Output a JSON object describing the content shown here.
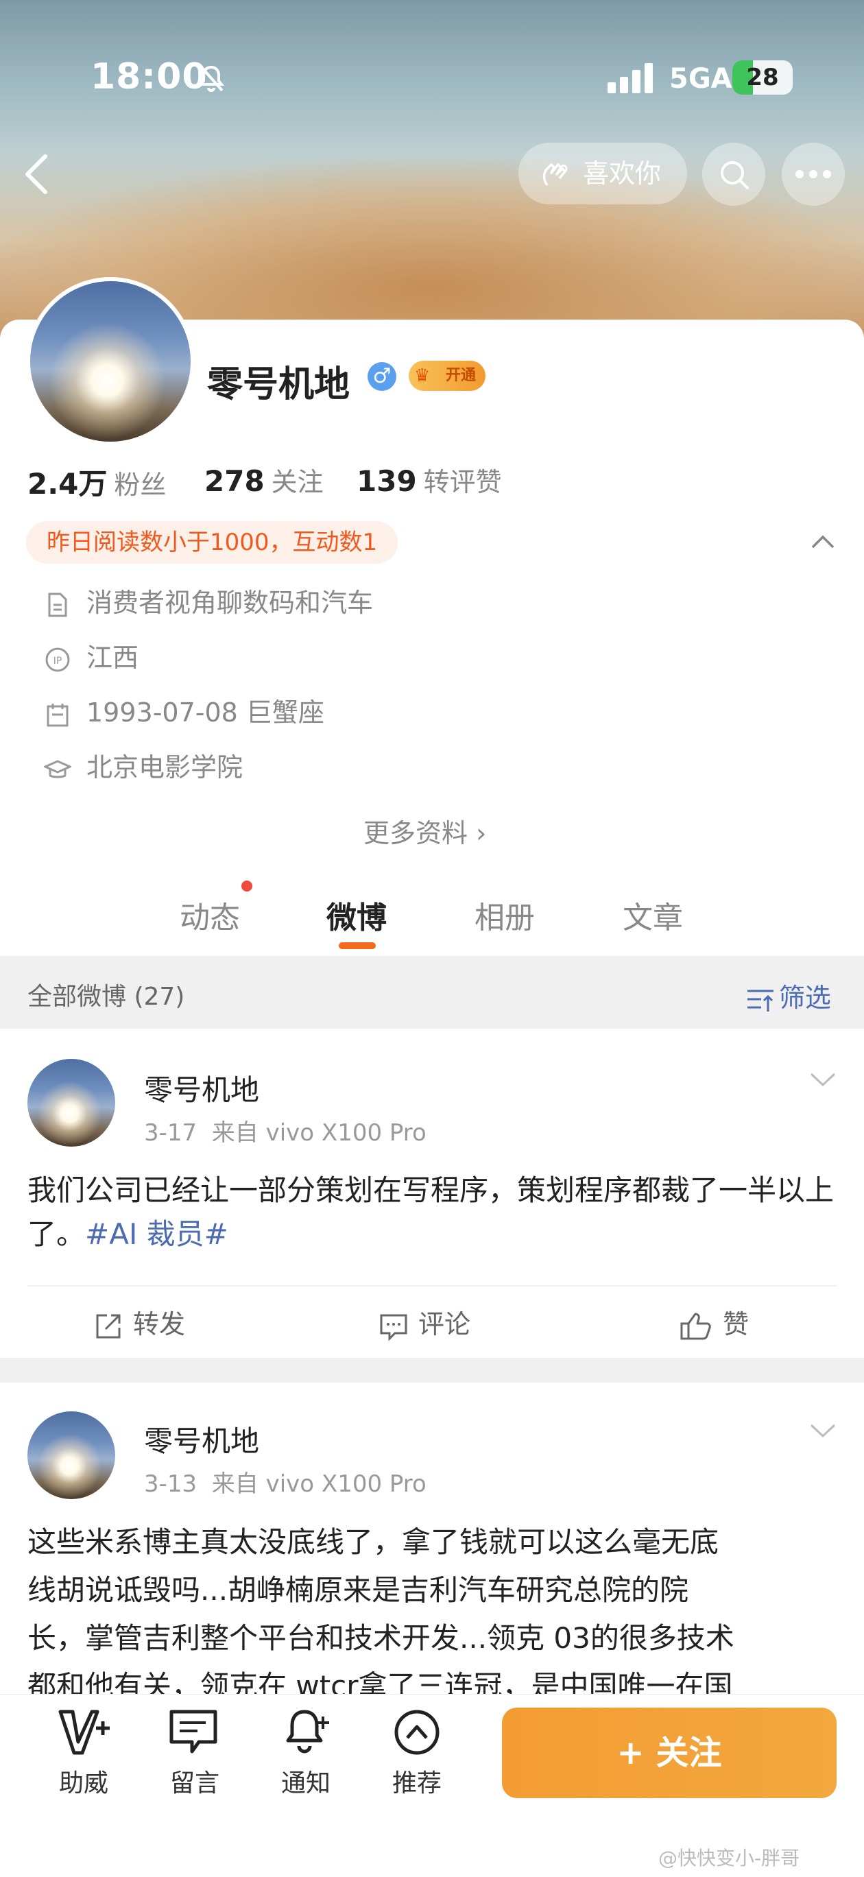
{
  "status_bar": {
    "time": "18:00",
    "network": "5GA",
    "battery": "28"
  },
  "header": {
    "like_label": "喜欢你"
  },
  "profile": {
    "name": "零号机地",
    "vip_label": "开通",
    "stats": [
      {
        "value": "2.4万",
        "label": "粉丝"
      },
      {
        "value": "278",
        "label": "关注"
      },
      {
        "value": "139",
        "label": "转评赞"
      }
    ],
    "notice": "昨日阅读数小于1000，互动数1",
    "info": {
      "bio": "消费者视角聊数码和汽车",
      "ip": "江西",
      "birthday": "1993-07-08 巨蟹座",
      "school": "北京电影学院"
    },
    "more_label": "更多资料 ›"
  },
  "tabs": [
    "动态",
    "微博",
    "相册",
    "文章"
  ],
  "filter": {
    "label": "全部微博 (27)",
    "button": "筛选"
  },
  "posts": [
    {
      "author": "零号机地",
      "date": "3-17",
      "source": "来自 vivo X100 Pro",
      "text": "我们公司已经让一部分策划在写程序，策划程序都裁了一半以上了。",
      "hashtag": "#AI 裁员#",
      "actions": {
        "repost": "转发",
        "comment": "评论",
        "like": "赞"
      }
    },
    {
      "author": "零号机地",
      "date": "3-13",
      "source": "来自 vivo X100 Pro",
      "text_lines": [
        "这些米系博主真太没底线了，拿了钱就可以这么毫无底",
        "线胡说诋毁吗...胡峥楠原来是吉利汽车研究总院的院",
        "长，掌管吉利整个平台和技术开发...领克 03的很多技术",
        "都和他有关，领克在 wtcr拿了三连冠，是中国唯一在国"
      ]
    }
  ],
  "bottom_nav": [
    {
      "label": "助威",
      "icon": "cheer-icon"
    },
    {
      "label": "留言",
      "icon": "message-icon"
    },
    {
      "label": "通知",
      "icon": "bell-icon"
    },
    {
      "label": "推荐",
      "icon": "recommend-icon"
    }
  ],
  "follow_button": "+ 关注",
  "watermark": "@快快变小-胖哥"
}
